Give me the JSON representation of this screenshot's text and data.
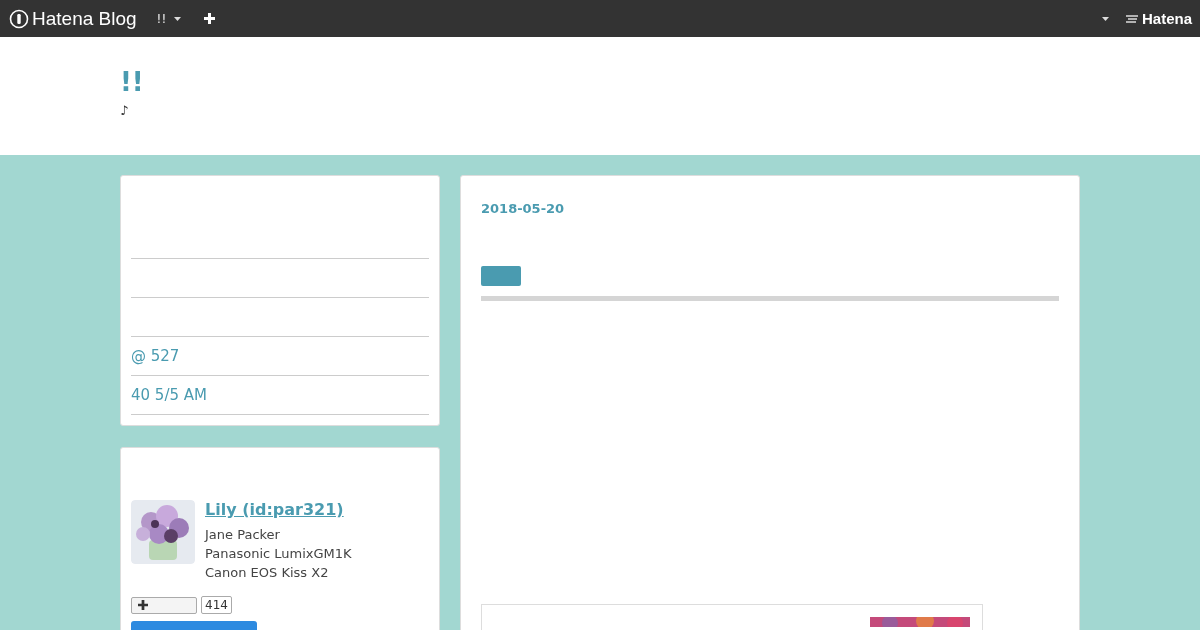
{
  "topbar": {
    "brand": "Hatena Blog",
    "blog_menu": "!!",
    "logo": "Hatena"
  },
  "header": {
    "title": "!!",
    "tagline": "♪"
  },
  "sidebar": {
    "links": [
      "@ 527",
      "40 5/5 AM"
    ],
    "profile": {
      "name": "Lily (id:par321)",
      "lines": [
        "Jane Packer",
        "Panasonic LumixGM1K",
        "Canon EOS Kiss X2"
      ],
      "bookmark_count": "414"
    }
  },
  "article": {
    "date": "2018-05-20"
  }
}
